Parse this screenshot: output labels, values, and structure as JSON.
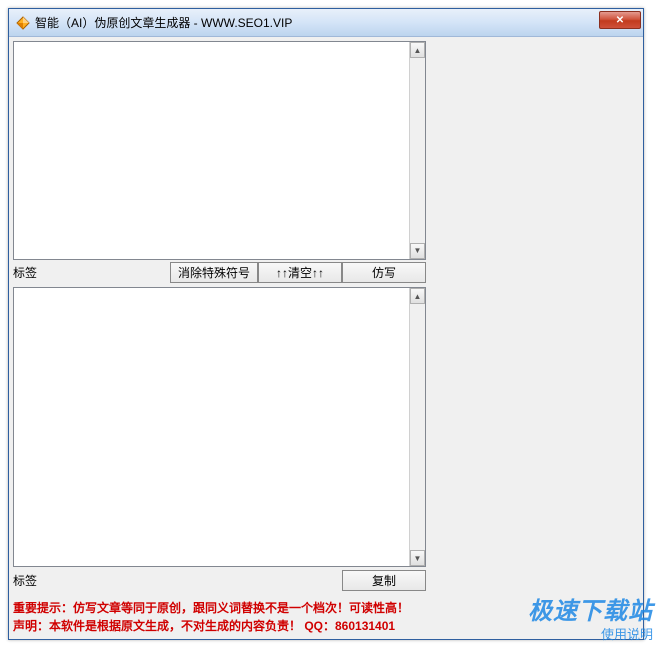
{
  "window": {
    "title": "智能（AI）伪原创文章生成器 - WWW.SEO1.VIP",
    "close_label": "✕"
  },
  "top": {
    "tag_label": "标签",
    "clear_special_btn": "消除特殊符号",
    "clear_btn": "↑↑清空↑↑",
    "rewrite_btn": "仿写",
    "textarea_value": ""
  },
  "bottom": {
    "tag_label": "标签",
    "copy_btn": "复制",
    "textarea_value": ""
  },
  "footer": {
    "line1": "重要提示：仿写文章等同于原创，跟同义词替换不是一个档次！可读性高！",
    "line2_a": "声明：本软件是根据原文生成，不对生成的内容负责！  ",
    "line2_b": "QQ：860131401"
  },
  "watermark": {
    "main": "极速下载站",
    "sub": "使用说明"
  },
  "icons": {
    "diamond": "diamond-icon"
  },
  "colors": {
    "titlebar_gradient_top": "#e8f0fa",
    "titlebar_gradient_bottom": "#bcd4ee",
    "close_red": "#c23b1e",
    "notice_red": "#d00000",
    "watermark_blue": "#1e88e5"
  }
}
